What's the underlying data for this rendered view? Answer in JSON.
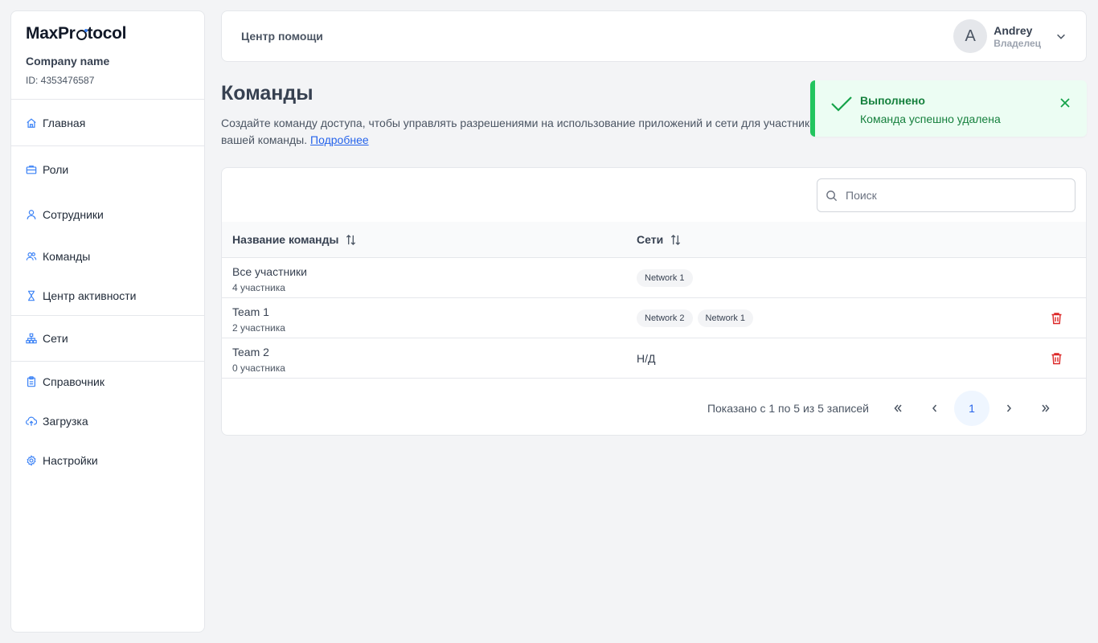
{
  "brand": {
    "logo_pre": "MaxPr",
    "logo_post": "tocol",
    "company_name": "Company name",
    "company_id": "ID: 4353476587"
  },
  "sidebar": {
    "items": [
      {
        "label": "Главная",
        "icon": "home-icon"
      },
      {
        "label": "Роли",
        "icon": "briefcase-icon"
      },
      {
        "label": "Сотрудники",
        "icon": "user-icon"
      },
      {
        "label": "Команды",
        "icon": "users-icon"
      },
      {
        "label": "Центр активности",
        "icon": "hourglass-icon"
      },
      {
        "label": "Сети",
        "icon": "network-icon"
      },
      {
        "label": "Справочник",
        "icon": "clipboard-icon"
      },
      {
        "label": "Загрузка",
        "icon": "cloud-upload-icon"
      },
      {
        "label": "Настройки",
        "icon": "gear-icon"
      }
    ]
  },
  "header": {
    "help_label": "Центр помощи",
    "user": {
      "initial": "A",
      "name": "Andrey",
      "role": "Владелец"
    }
  },
  "page": {
    "title": "Команды",
    "description": "Создайте команду доступа, чтобы управлять разрешениями на использование приложений и сети для участников вашей команды.",
    "more_link": "Подробнее"
  },
  "toast": {
    "title": "Выполнено",
    "message": "Команда успешно удалена"
  },
  "search": {
    "placeholder": "Поиск",
    "value": ""
  },
  "table": {
    "columns": [
      "Название команды",
      "Сети"
    ],
    "rows": [
      {
        "name": "Все участники",
        "count": "4 участника",
        "networks": [
          "Network 1"
        ],
        "deletable": false
      },
      {
        "name": "Team 1",
        "count": "2 участника",
        "networks": [
          "Network 2",
          "Network 1"
        ],
        "deletable": true
      },
      {
        "name": "Team 2",
        "count": "0 участника",
        "networks": [],
        "na": "Н/Д",
        "deletable": true
      }
    ]
  },
  "pagination": {
    "info": "Показано с 1 по 5 из 5 записей",
    "current_page": "1"
  },
  "colors": {
    "accent": "#3b82f6",
    "success": "#22c55e",
    "danger": "#dc2626"
  }
}
